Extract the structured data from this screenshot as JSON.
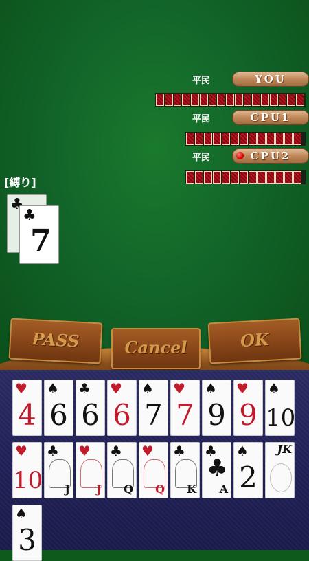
{
  "players": [
    {
      "rank": "平民",
      "name": "YOU",
      "turn": false,
      "cards": 17
    },
    {
      "rank": "平民",
      "name": "CPU1",
      "turn": false,
      "cards": 13
    },
    {
      "rank": "平民",
      "name": "CPU2",
      "turn": true,
      "cards": 13
    }
  ],
  "shibari_label": "[縛り]",
  "table_cards": [
    {
      "suit": "♣",
      "rank": ""
    },
    {
      "suit": "♣",
      "rank": "7"
    }
  ],
  "buttons": {
    "pass": "PASS",
    "cancel": "Cancel",
    "ok": "OK"
  },
  "hand": [
    {
      "suit": "♥",
      "rank": "4",
      "color": "red"
    },
    {
      "suit": "♠",
      "rank": "6",
      "color": "black"
    },
    {
      "suit": "♣",
      "rank": "6",
      "color": "black"
    },
    {
      "suit": "♥",
      "rank": "6",
      "color": "red"
    },
    {
      "suit": "♠",
      "rank": "7",
      "color": "black"
    },
    {
      "suit": "♥",
      "rank": "7",
      "color": "red"
    },
    {
      "suit": "♠",
      "rank": "9",
      "color": "black"
    },
    {
      "suit": "♥",
      "rank": "9",
      "color": "red"
    },
    {
      "suit": "♠",
      "rank": "10",
      "color": "black"
    },
    {
      "suit": "♥",
      "rank": "10",
      "color": "red"
    },
    {
      "suit": "♣",
      "rank": "J",
      "color": "black"
    },
    {
      "suit": "♥",
      "rank": "J",
      "color": "red"
    },
    {
      "suit": "♣",
      "rank": "Q",
      "color": "black"
    },
    {
      "suit": "♥",
      "rank": "Q",
      "color": "red"
    },
    {
      "suit": "♣",
      "rank": "K",
      "color": "black"
    },
    {
      "suit": "♣",
      "rank": "A",
      "color": "black"
    },
    {
      "suit": "♠",
      "rank": "2",
      "color": "black"
    },
    {
      "suit": "",
      "rank": "JK",
      "color": "black"
    },
    {
      "suit": "♠",
      "rank": "3",
      "color": "black"
    }
  ],
  "colors": {
    "felt": "#12652a",
    "rail": "#8a4f1b",
    "hand_bg": "#1f1f55",
    "card_back": "#b8121e",
    "turn_marker": "#e00000"
  }
}
